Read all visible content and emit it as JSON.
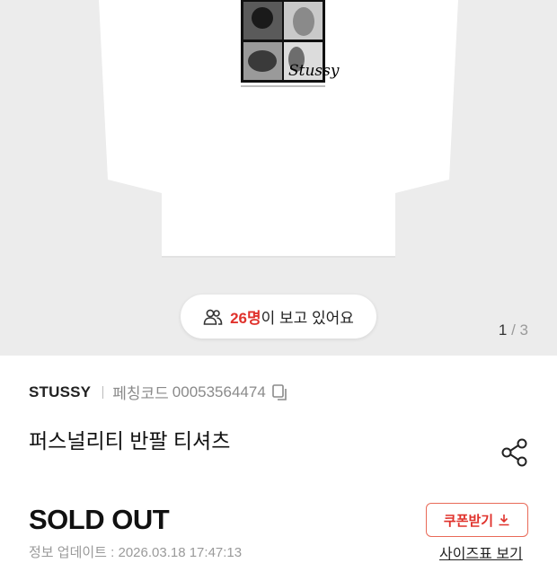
{
  "gallery": {
    "viewers_count": "26명",
    "viewers_suffix": "이 보고 있어요",
    "pager_current": "1",
    "pager_sep": "/",
    "pager_total": "3"
  },
  "product": {
    "brand": "STUSSY",
    "code_label": "페칭코드",
    "code_value": "00053564474",
    "title": "퍼스널리티 반팔 티셔츠",
    "status": "SOLD OUT",
    "updated": "정보 업데이트 : 2026.03.18 17:47:13",
    "graphic_text": "Stussy"
  },
  "actions": {
    "coupon_label": "쿠폰받기",
    "size_chart_label": "사이즈표 보기"
  },
  "colors": {
    "accent": "#e0322c",
    "image_bg": "#ececec"
  },
  "icons": [
    "users-icon",
    "copy-icon",
    "share-icon",
    "download-icon"
  ]
}
